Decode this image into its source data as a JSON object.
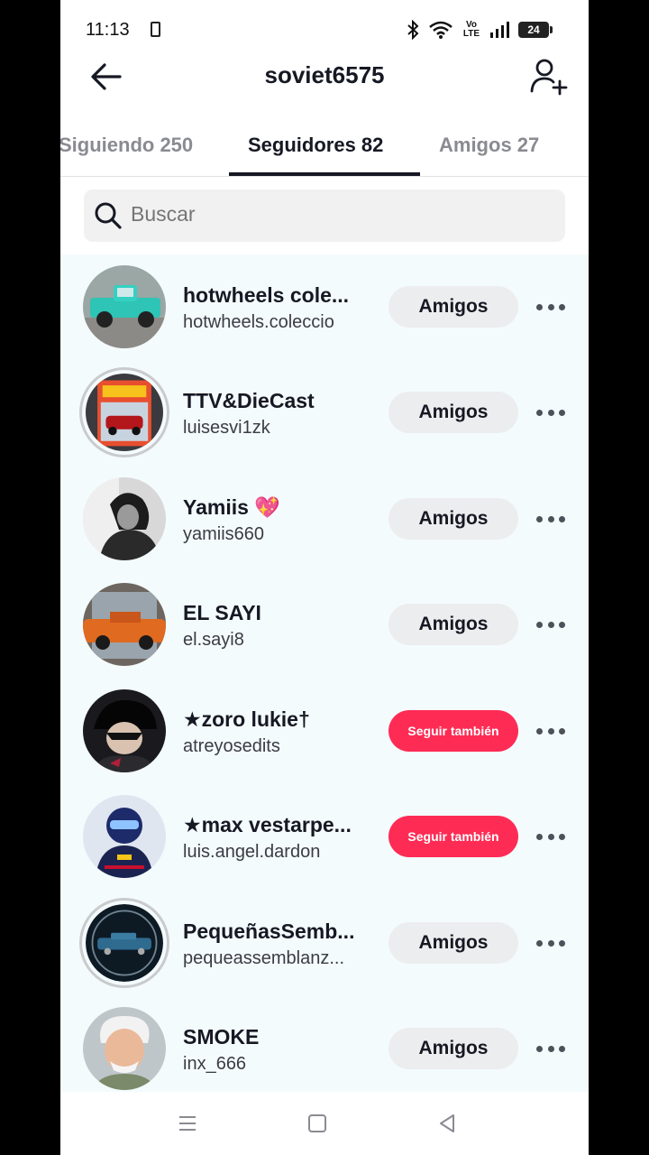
{
  "status": {
    "time": "11:13",
    "volte": "Vo\nLTE",
    "battery": "24"
  },
  "header": {
    "title": "soviet6575"
  },
  "tabs": [
    {
      "label": "Siguiendo 250"
    },
    {
      "label": "Seguidores 82"
    },
    {
      "label": "Amigos 27"
    }
  ],
  "search": {
    "placeholder": "Buscar"
  },
  "colors": {
    "accent": "#fe2c55",
    "list_bg": "#f4fbfd",
    "button_gray": "#ecedee"
  },
  "users": [
    {
      "name": "hotwheels cole...",
      "handle": "hotwheels.coleccio",
      "button": "Amigos"
    },
    {
      "name": "TTV&DieCast",
      "handle": "luisesvi1zk",
      "button": "Amigos"
    },
    {
      "name": "Yamiis 💖",
      "handle": "yamiis660",
      "button": "Amigos"
    },
    {
      "name": "EL SAYI",
      "handle": "el.sayi8",
      "button": "Amigos"
    },
    {
      "name": "★zoro lukie†",
      "handle": "atreyosedits",
      "button": "Seguir también"
    },
    {
      "name": "★max vestarpe...",
      "handle": "luis.angel.dardon",
      "button": "Seguir también"
    },
    {
      "name": "PequeñasSemb...",
      "handle": "pequeassemblanz...",
      "button": "Amigos"
    },
    {
      "name": "SMOKE",
      "handle": "inx_666",
      "button": "Amigos"
    }
  ]
}
